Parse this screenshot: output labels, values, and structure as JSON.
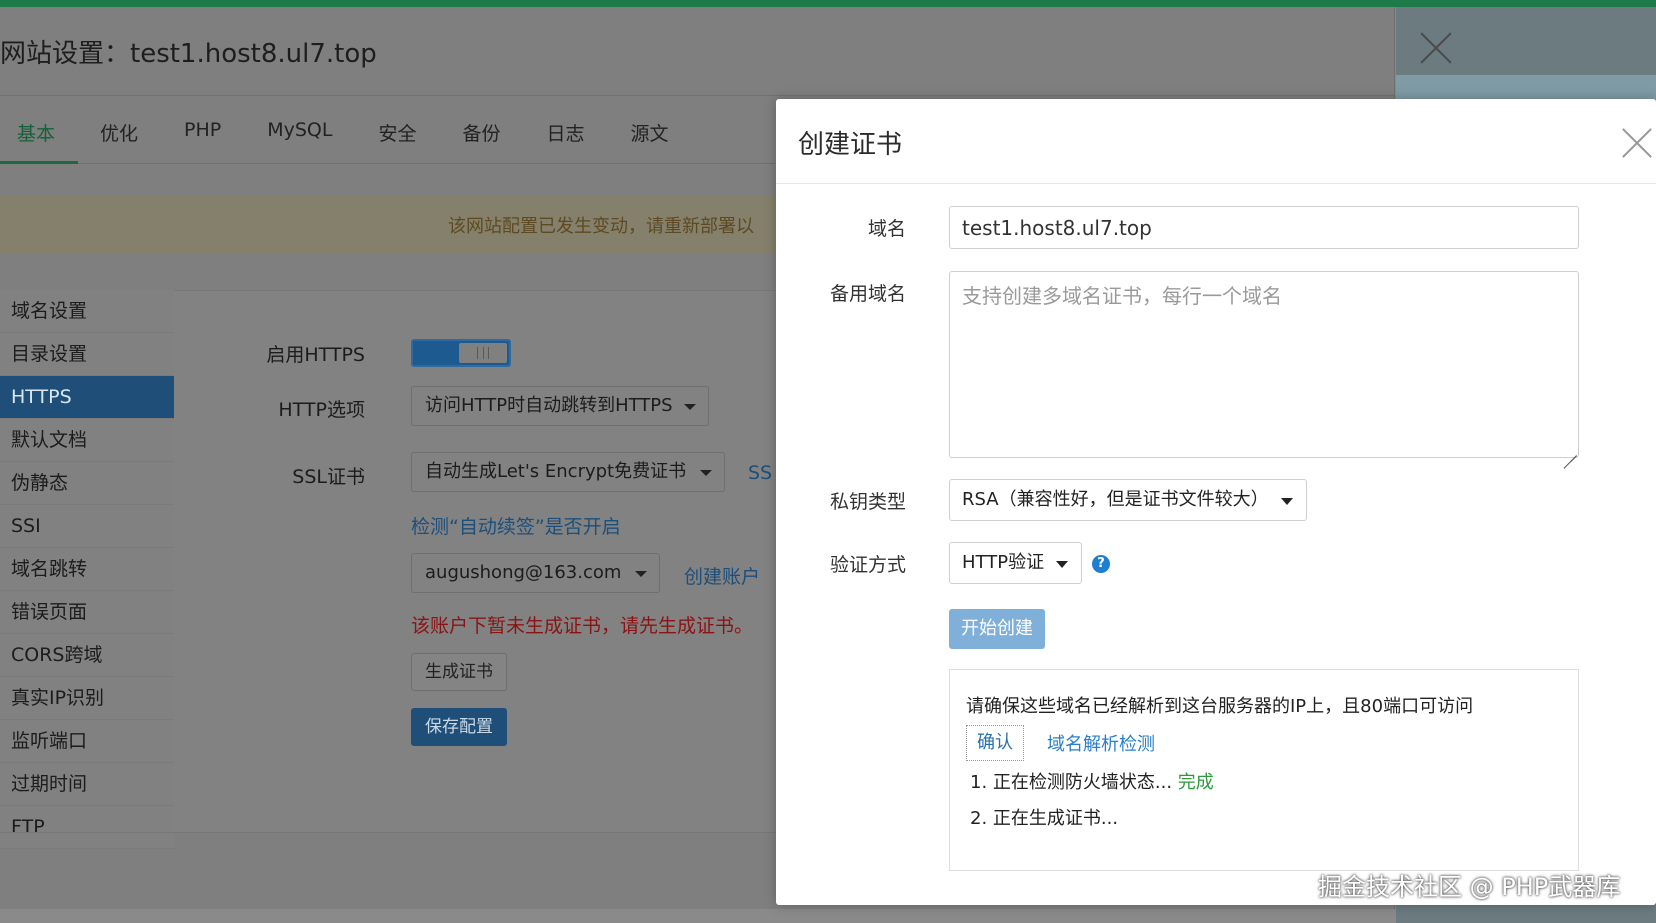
{
  "site_window": {
    "title": "网站设置：test1.host8.ul7.top",
    "tabs": [
      "基本",
      "优化",
      "PHP",
      "MySQL",
      "安全",
      "备份",
      "日志",
      "源文"
    ],
    "notice": "该网站配置已发生变动，请重新部署以",
    "sidebar": [
      "域名设置",
      "目录设置",
      "HTTPS",
      "默认文档",
      "伪静态",
      "SSI",
      "域名跳转",
      "错误页面",
      "CORS跨域",
      "真实IP识别",
      "监听端口",
      "过期时间",
      "FTP"
    ],
    "https_form": {
      "enable_label": "启用HTTPS",
      "http_option_label": "HTTP选项",
      "http_option_value": "访问HTTP时自动跳转到HTTPS",
      "ssl_label": "SSL证书",
      "ssl_value": "自动生成Let's Encrypt免费证书",
      "ssl_link_partial": "SS",
      "check_renew_link": "检测“自动续签”是否开启",
      "account_value": "augushong@163.com",
      "create_account_link": "创建账户",
      "error_text": "该账户下暂未生成证书，请先生成证书。",
      "generate_button": "生成证书",
      "save_button": "保存配置"
    }
  },
  "modal": {
    "title": "创建证书",
    "domain_label": "域名",
    "domain_value": "test1.host8.ul7.top",
    "alt_domain_label": "备用域名",
    "alt_domain_placeholder": "支持创建多域名证书，每行一个域名",
    "key_type_label": "私钥类型",
    "key_type_value": "RSA（兼容性好，但是证书文件较大）",
    "verify_label": "验证方式",
    "verify_value": "HTTP验证",
    "help_icon": "?",
    "start_button": "开始创建",
    "info_text": "请确保这些域名已经解析到这台服务器的IP上，且80端口可访问",
    "confirm_button": "确认",
    "dns_check_link": "域名解析检测",
    "step1": "1. 正在检测防火墙状态...",
    "step1_status": "完成",
    "step2": "2. 正在生成证书..."
  },
  "watermark": "掘金技术社区 @ PHP武器库"
}
